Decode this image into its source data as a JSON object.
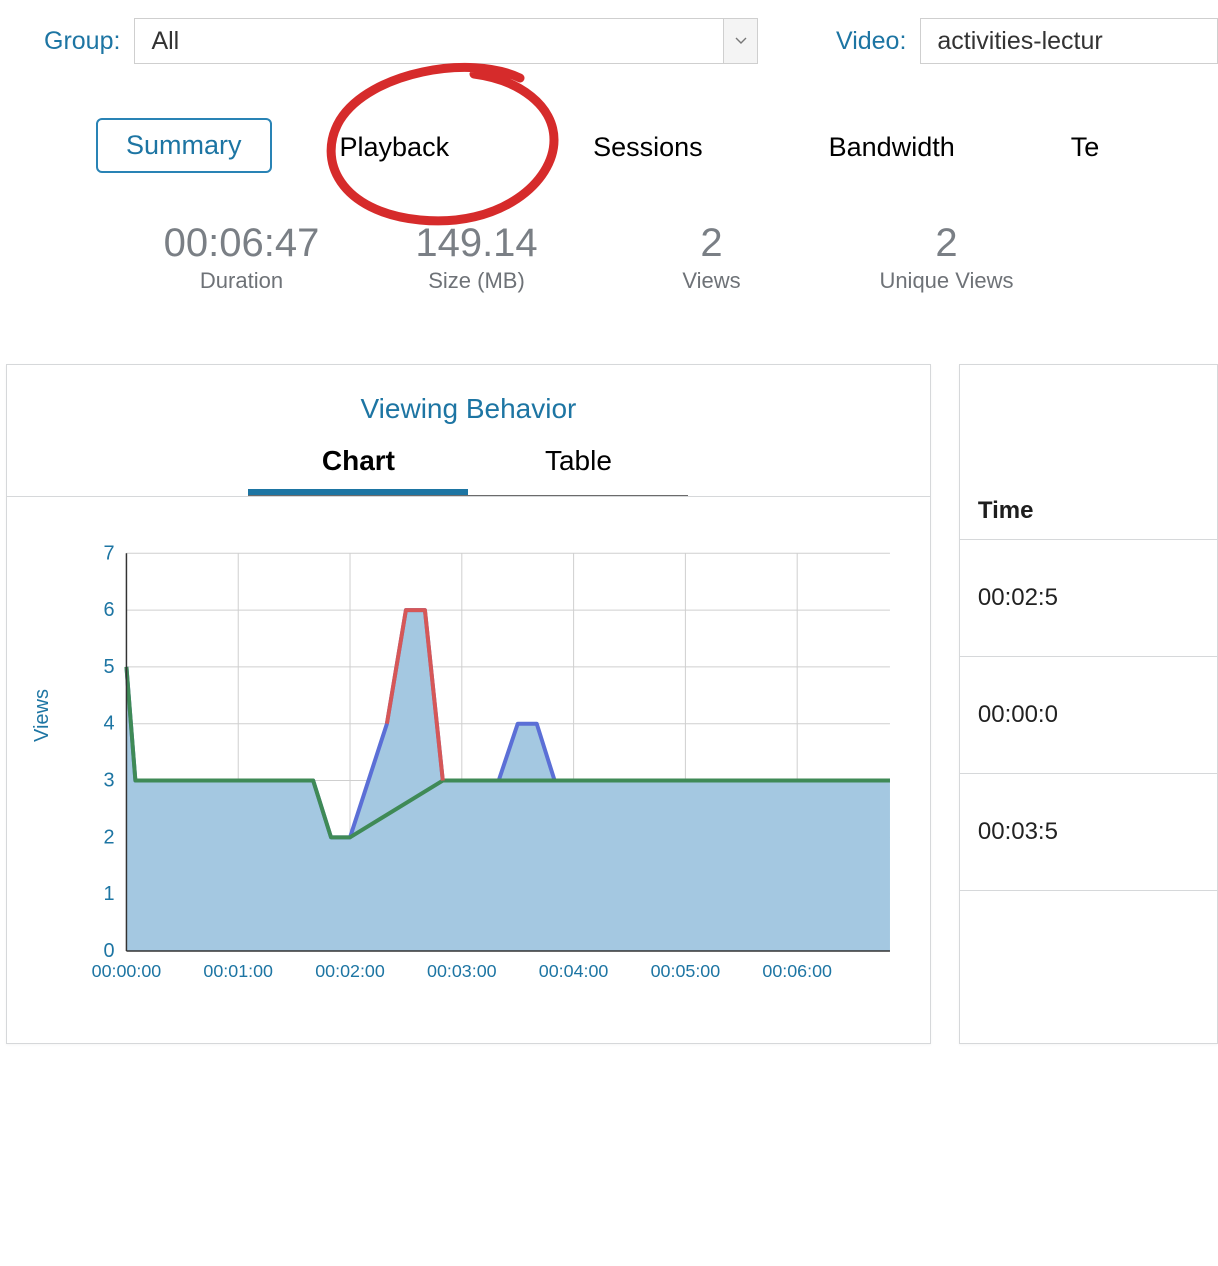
{
  "filters": {
    "group_label": "Group:",
    "group_value": "All",
    "video_label": "Video:",
    "video_value": "activities-lectur"
  },
  "tabs": {
    "items": [
      {
        "label": "Summary",
        "active": true
      },
      {
        "label": "Playback",
        "active": false
      },
      {
        "label": "Sessions",
        "active": false
      },
      {
        "label": "Bandwidth",
        "active": false
      },
      {
        "label": "Te",
        "active": false
      }
    ]
  },
  "stats": {
    "duration_val": "00:06:47",
    "duration_lab": "Duration",
    "size_val": "149.14",
    "size_lab": "Size (MB)",
    "views_val": "2",
    "views_lab": "Views",
    "uviews_val": "2",
    "uviews_lab": "Unique Views"
  },
  "chart_panel": {
    "title": "Viewing Behavior",
    "subtabs": {
      "chart": "Chart",
      "table": "Table"
    },
    "y_title": "Views"
  },
  "side_panel": {
    "header": "Time",
    "rows": [
      "00:02:5",
      "00:00:0",
      "00:03:5"
    ]
  },
  "chart_data": {
    "type": "area",
    "xlabel": "",
    "ylabel": "Views",
    "ylim": [
      0,
      7
    ],
    "x_ticks": [
      "00:00:00",
      "00:01:00",
      "00:02:00",
      "00:03:00",
      "00:04:00",
      "00:05:00",
      "00:06:00"
    ],
    "y_ticks": [
      0,
      1,
      2,
      3,
      4,
      5,
      6,
      7
    ],
    "series": [
      {
        "name": "views-area",
        "color": "#a4c8e1",
        "x": [
          0,
          0.08,
          1.67,
          1.83,
          2.0,
          2.33,
          2.5,
          2.67,
          2.83,
          3.33,
          3.5,
          3.67,
          3.83,
          6.83
        ],
        "values": [
          5,
          3,
          3,
          2,
          2,
          4,
          6,
          6,
          3,
          3,
          4,
          4,
          3,
          3
        ]
      },
      {
        "name": "blue-line",
        "color": "#5b6fd6",
        "x": [
          0,
          0.08,
          1.67,
          1.83,
          2.0,
          2.33,
          2.5,
          2.67,
          2.83,
          3.33,
          3.5,
          3.67,
          3.83,
          6.83
        ],
        "values": [
          5,
          3,
          3,
          2,
          2,
          4,
          6,
          6,
          3,
          3,
          4,
          4,
          3,
          3
        ]
      },
      {
        "name": "green-line",
        "color": "#3f8a56",
        "x": [
          0,
          0.08,
          1.67,
          1.83,
          2.0,
          2.83,
          3.33,
          3.83,
          6.83
        ],
        "values": [
          5,
          3,
          3,
          2,
          2,
          3,
          3,
          3,
          3
        ]
      },
      {
        "name": "red-line",
        "color": "#d65757",
        "x": [
          2.33,
          2.5,
          2.67,
          2.83
        ],
        "values": [
          4,
          6,
          6,
          3
        ]
      }
    ]
  }
}
